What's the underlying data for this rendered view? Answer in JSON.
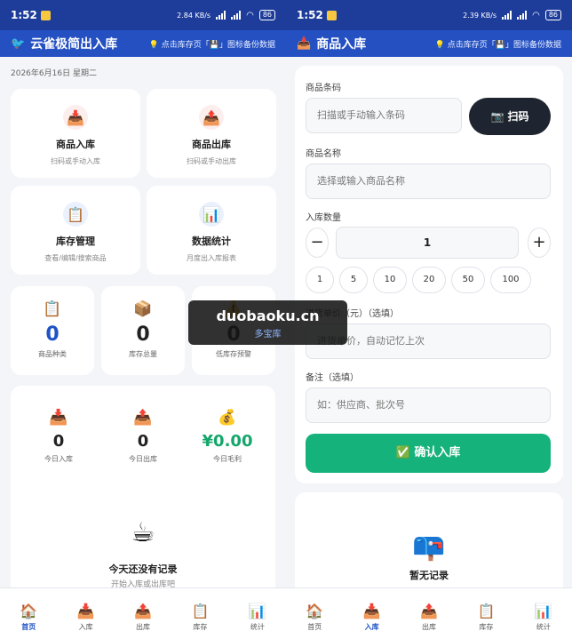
{
  "status_bar": {
    "left_time": "1:52",
    "left_speed": "2.84 KB/s",
    "right_time": "1:52",
    "right_speed": "2.39 KB/s",
    "battery": "86"
  },
  "home": {
    "app_title": "云雀极简出入库",
    "backup_hint": "💡 点击库存页「💾」图标备份数据",
    "date": "2026年6月16日 星期二",
    "actions": [
      {
        "icon": "📥",
        "title": "商品入库",
        "subtitle": "扫码或手动入库"
      },
      {
        "icon": "📤",
        "title": "商品出库",
        "subtitle": "扫码或手动出库"
      },
      {
        "icon": "📋",
        "title": "库存管理",
        "subtitle": "查看/编辑/搜索商品"
      },
      {
        "icon": "📊",
        "title": "数据统计",
        "subtitle": "月度出入库报表"
      }
    ],
    "stats": [
      {
        "icon": "📋",
        "value": "0",
        "label": "商品种类"
      },
      {
        "icon": "📦",
        "value": "0",
        "label": "库存总量"
      },
      {
        "icon": "⚠️",
        "value": "0",
        "label": "低库存预警"
      }
    ],
    "today": [
      {
        "icon": "📥",
        "value": "0",
        "label": "今日入库"
      },
      {
        "icon": "📤",
        "value": "0",
        "label": "今日出库"
      },
      {
        "icon": "💰",
        "value": "¥0.00",
        "label": "今日毛利"
      }
    ],
    "empty_icon": "☕",
    "empty_title": "今天还没有记录",
    "empty_sub": "开始入库或出库吧"
  },
  "inbound": {
    "title": "商品入库",
    "backup_hint": "💡 点击库存页「💾」图标备份数据",
    "barcode_label": "商品条码",
    "barcode_placeholder": "扫描或手动输入条码",
    "scan_button": "📷 扫码",
    "name_label": "商品名称",
    "name_placeholder": "选择或输入商品名称",
    "qty_label": "入库数量",
    "qty_value": "1",
    "minus": "−",
    "plus": "+",
    "quick_qty": [
      "1",
      "5",
      "10",
      "20",
      "50",
      "100"
    ],
    "price_label": "进货单价（元）（选填）",
    "price_placeholder": "进货单价，自动记忆上次",
    "note_label": "备注（选填）",
    "note_placeholder": "如：供应商、批次号",
    "confirm_button": "✅ 确认入库",
    "records_icon": "📪",
    "records_empty": "暂无记录"
  },
  "tabs_left": [
    {
      "icon": "🏠",
      "label": "首页"
    },
    {
      "icon": "📥",
      "label": "入库"
    },
    {
      "icon": "📤",
      "label": "出库"
    },
    {
      "icon": "📋",
      "label": "库存"
    },
    {
      "icon": "📊",
      "label": "统计"
    }
  ],
  "tabs_right": [
    {
      "icon": "🏠",
      "label": "首页"
    },
    {
      "icon": "📥",
      "label": "入库"
    },
    {
      "icon": "📤",
      "label": "出库"
    },
    {
      "icon": "📋",
      "label": "库存"
    },
    {
      "icon": "📊",
      "label": "统计"
    }
  ],
  "watermark": {
    "line1": "duobaoku.cn",
    "line2": "多宝库"
  }
}
